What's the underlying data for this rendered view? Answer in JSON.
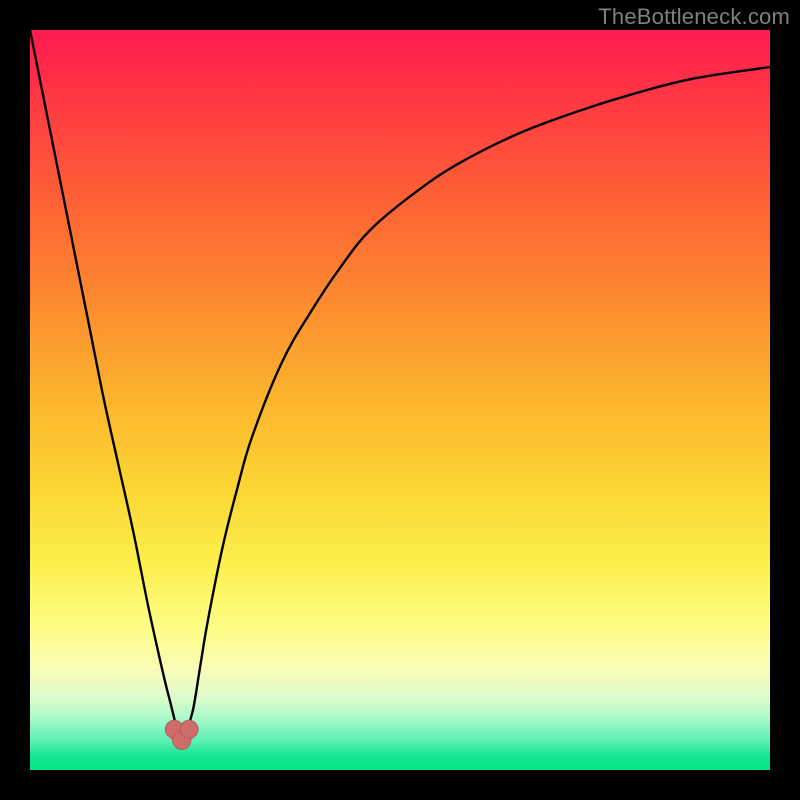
{
  "watermark": "TheBottleneck.com",
  "colors": {
    "frame": "#000000",
    "curve_stroke": "#000000",
    "marker_fill": "#cf6d6a",
    "marker_stroke": "#b85a57",
    "gradient_top": "#ff1a4f",
    "gradient_bottom": "#00e386"
  },
  "chart_data": {
    "type": "line",
    "title": "",
    "xlabel": "",
    "ylabel": "",
    "xlim": [
      0,
      100
    ],
    "ylim": [
      0,
      100
    ],
    "grid": false,
    "legend": false,
    "series": [
      {
        "name": "bottleneck-curve",
        "x": [
          0,
          2,
          4,
          6,
          8,
          10,
          12,
          14,
          16,
          18,
          19,
          20,
          20.5,
          21,
          22,
          23,
          24,
          26,
          28,
          30,
          34,
          38,
          42,
          46,
          52,
          58,
          66,
          74,
          82,
          90,
          100
        ],
        "y": [
          100,
          90,
          80,
          70,
          60,
          50,
          41,
          32,
          22,
          13,
          9,
          5,
          4,
          5,
          8,
          14,
          20,
          30,
          38,
          45,
          55,
          62,
          68,
          73,
          78,
          82,
          86,
          89,
          91.5,
          93.5,
          95
        ]
      }
    ],
    "markers": [
      {
        "name": "min-left",
        "x": 19.5,
        "y": 5.5
      },
      {
        "name": "min-bottom",
        "x": 20.5,
        "y": 4.0
      },
      {
        "name": "min-right",
        "x": 21.5,
        "y": 5.5
      }
    ]
  }
}
